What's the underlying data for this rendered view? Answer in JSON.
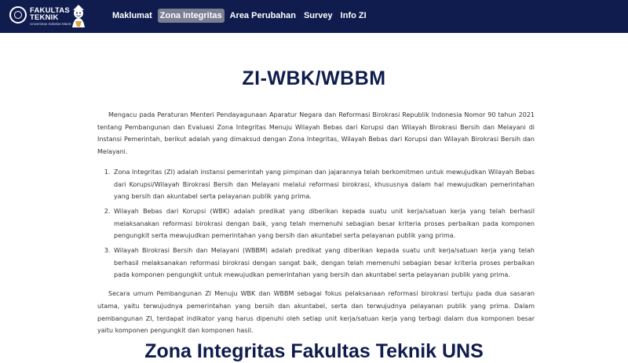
{
  "brand": {
    "title_line1": "FAKULTAS",
    "title_line2": "TEKNIK",
    "subtitle": "Universitas Sebelas Maret"
  },
  "nav": {
    "items": [
      {
        "label": "Maklumat",
        "active": false
      },
      {
        "label": "Zona Integritas",
        "active": true
      },
      {
        "label": "Area Perubahan",
        "active": false
      },
      {
        "label": "Survey",
        "active": false
      },
      {
        "label": "Info ZI",
        "active": false
      }
    ]
  },
  "main": {
    "title": "ZI-WBK/WBBM",
    "intro": "Mengacu pada Peraturan Menteri Pendayagunaan Aparatur Negara dan Reformasi Birokrasi Republik Indonesia Nomor 90 tahun 2021 tentang Pembangunan dan Evaluasi Zona Integritas Menuju Wilayah Bebas dari Korupsi dan Wilayah Birokrasi Bersih dan Melayani di Instansi Pemerintah, berikut adalah yang dimaksud dengan Zona Integritas, Wilayah Bebas dari Korupsi dan Wilayah Birokrasi Bersih dan Melayani.",
    "definitions": [
      "Zona Integritas (ZI) adalah instansi pemerintah yang pimpinan dan jajarannya telah berkomitmen untuk mewujudkan Wilayah Bebas dari Korupsi/Wilayah Birokrasi Bersih dan Melayani melalui reformasi birokrasi, khususnya dalam hal mewujudkan pemerintahan yang bersih dan akuntabel serta pelayanan publik yang prima.",
      "Wilayah Bebas dari Korupsi (WBK) adalah predikat yang diberikan kepada suatu unit kerja/satuan kerja yang telah berhasil melaksanakan reformasi birokrasi dengan baik, yang telah memenuhi sebagian besar kriteria proses perbaikan pada komponen pengungkit serta mewujudkan pemerintahan yang bersih dan akuntabel serta pelayanan publik yang prima.",
      "Wilayah Birokrasi Bersih dan Melayani (WBBM) adalah predikat yang diberikan kepada suatu unit kerja/satuan kerja yang telah berhasil melaksanakan reformasi birokrasi dengan sangat baik, dengan telah memenuhi sebagian besar kriteria proses perbaikan pada komponen pengungkit untuk mewujudkan pemerintahan yang bersih dan akuntabel serta pelayanan publik yang prima."
    ],
    "closing": "Secara umum Pembangunan ZI Menuju WBK dan WBBM sebagai fokus pelaksanaan reformasi birokrasi tertuju pada dua sasaran utama, yaitu terwujudnya pemerintahan yang bersih dan akuntabel, serta dan terwujudnya pelayanan publik yang prima. Dalam pembangunan ZI, terdapat indikator yang harus dipenuhi oleh setiap unit kerja/satuan kerja yang terbagi dalam dua komponen besar yaitu komponen pengungkit dan komponen hasil.",
    "next_section_title": "Zona Integritas Fakultas Teknik UNS"
  },
  "icons": {
    "logo": "university-seal-icon",
    "mascot": "mascot-icon"
  },
  "colors": {
    "navbar": "#0f1c4d",
    "active_nav": "#7a7f93",
    "heading": "#0f1c4d",
    "body_text": "#333333"
  }
}
